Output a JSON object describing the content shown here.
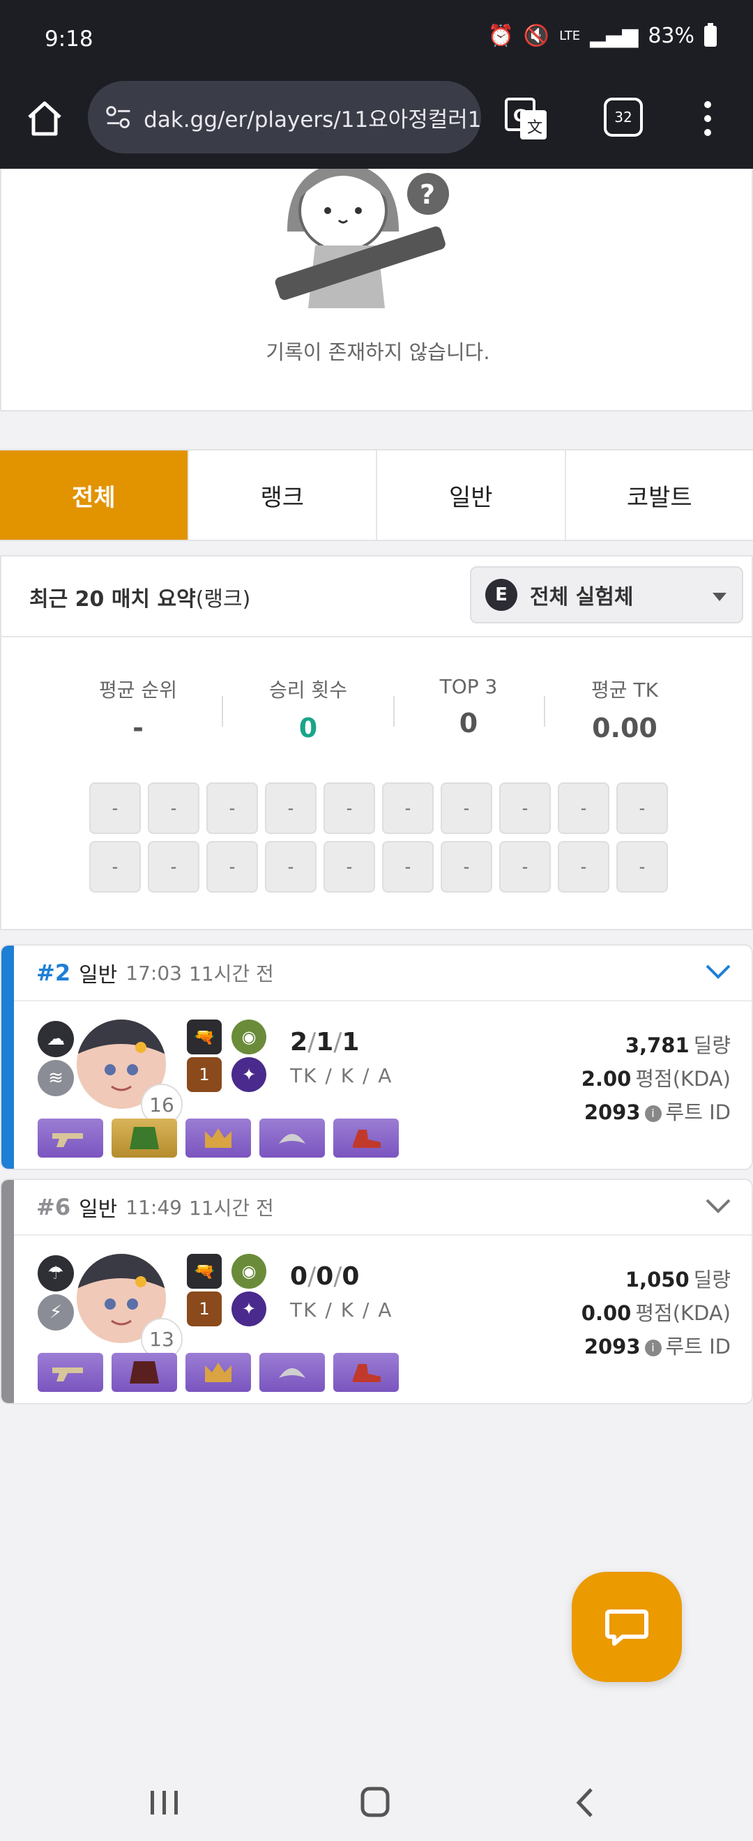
{
  "status": {
    "time": "9:18",
    "battery": "83%",
    "network": "LTE"
  },
  "browser": {
    "url": "dak.gg/er/players/11요아정컬러11",
    "tab_count": "32"
  },
  "empty_state": {
    "message": "기록이 존재하지 않습니다."
  },
  "mode_tabs": [
    {
      "label": "전체",
      "active": true
    },
    {
      "label": "랭크",
      "active": false
    },
    {
      "label": "일반",
      "active": false
    },
    {
      "label": "코발트",
      "active": false
    }
  ],
  "summary": {
    "title_bold": "최근 20 매치 요약",
    "title_suffix": "(랭크)",
    "character_select": "전체 실험체",
    "stats": [
      {
        "label": "평균 순위",
        "value": "-"
      },
      {
        "label": "승리 횟수",
        "value": "0"
      },
      {
        "label": "TOP 3",
        "value": "0"
      },
      {
        "label": "평균 TK",
        "value": "0.00"
      }
    ],
    "placeholder": "-"
  },
  "matches": [
    {
      "rank": "#2",
      "mode": "일반",
      "time": "17:03",
      "ago": "11시간 전",
      "accent": "#1e7fd6",
      "level": "16",
      "kda": {
        "tk": "2",
        "k": "1",
        "a": "1",
        "label": "TK / K / A"
      },
      "damage": "3,781",
      "damage_label": "딜량",
      "kda_score": "2.00",
      "kda_score_label": "평점(KDA)",
      "route_id": "2093",
      "route_label": "루트 ID",
      "skill_badge": "1"
    },
    {
      "rank": "#6",
      "mode": "일반",
      "time": "11:49",
      "ago": "11시간 전",
      "accent": "#8e8e93",
      "level": "13",
      "kda": {
        "tk": "0",
        "k": "0",
        "a": "0",
        "label": "TK / K / A"
      },
      "damage": "1,050",
      "damage_label": "딜량",
      "kda_score": "0.00",
      "kda_score_label": "평점(KDA)",
      "route_id": "2093",
      "route_label": "루트 ID",
      "skill_badge": "1"
    }
  ],
  "colors": {
    "accent_orange": "#e29300",
    "win_green": "#19a58a"
  }
}
